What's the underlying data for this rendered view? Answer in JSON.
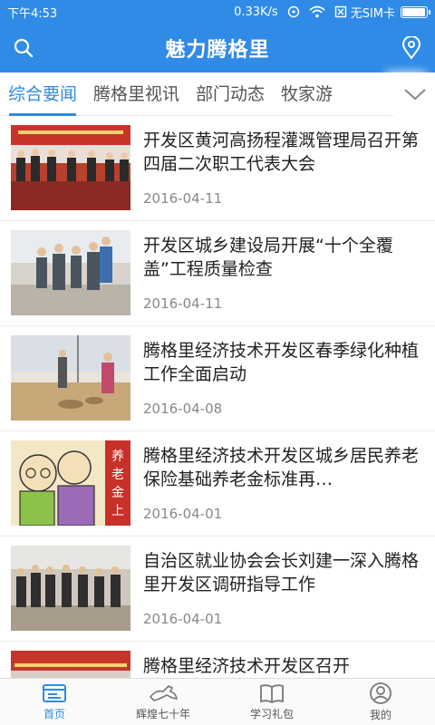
{
  "status": {
    "time": "下午4:53",
    "speed": "0.33K/s",
    "sim": "无SIM卡",
    "battery_level": 0.95
  },
  "app": {
    "title": "魅力腾格里"
  },
  "tabs": [
    {
      "label": "综合要闻"
    },
    {
      "label": "腾格里视讯"
    },
    {
      "label": "部门动态"
    },
    {
      "label": "牧家游"
    }
  ],
  "news": [
    {
      "headline": "开发区黄河高扬程灌溉管理局召开第四届二次职工代表大会",
      "date": "2016-04-11"
    },
    {
      "headline": "开发区城乡建设局开展“十个全覆盖”工程质量检查",
      "date": "2016-04-11"
    },
    {
      "headline": "腾格里经济技术开发区春季绿化种植工作全面启动",
      "date": "2016-04-08"
    },
    {
      "headline": "腾格里经济技术开发区城乡居民养老保险基础养老金标准再…",
      "date": "2016-04-01"
    },
    {
      "headline": "自治区就业协会会长刘建一深入腾格里开发区调研指导工作",
      "date": "2016-04-01"
    },
    {
      "headline": "腾格里经济技术开发区召开",
      "date": ""
    }
  ],
  "bottom_nav": [
    {
      "label": "首页"
    },
    {
      "label": "辉煌七十年"
    },
    {
      "label": "学习礼包"
    },
    {
      "label": "我的"
    }
  ]
}
